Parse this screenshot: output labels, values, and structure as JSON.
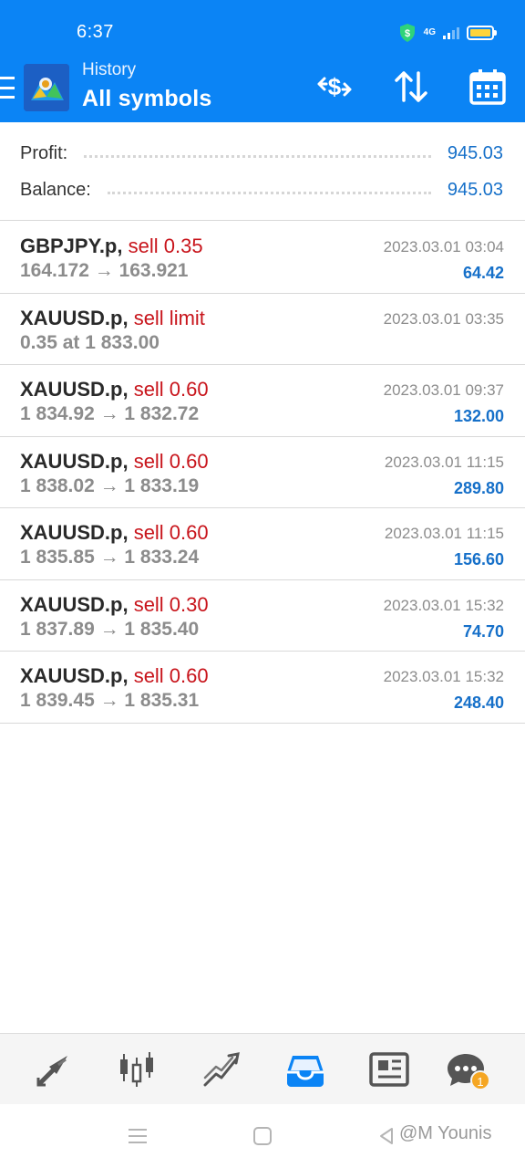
{
  "status_bar": {
    "time": "6:37",
    "network": "4G",
    "battery_color": "#ffd43b"
  },
  "header": {
    "menu_icon": "hamburger-icon",
    "subtitle": "History",
    "title": "All symbols",
    "actions": [
      "deposit-withdraw-icon",
      "sort-icon",
      "calendar-icon"
    ]
  },
  "summary": {
    "profit_label": "Profit:",
    "profit_value": "945.03",
    "balance_label": "Balance:",
    "balance_value": "945.03"
  },
  "trades": [
    {
      "symbol": "GBPJPY.p,",
      "side": "sell 0.35",
      "prices": "164.172 → 163.921",
      "time": "2023.03.01 03:04",
      "profit": "64.42"
    },
    {
      "symbol": "XAUUSD.p,",
      "side": "sell limit",
      "prices": "0.35 at 1 833.00",
      "time": "2023.03.01 03:35",
      "profit": ""
    },
    {
      "symbol": "XAUUSD.p,",
      "side": "sell 0.60",
      "prices": "1 834.92 → 1 832.72",
      "time": "2023.03.01 09:37",
      "profit": "132.00"
    },
    {
      "symbol": "XAUUSD.p,",
      "side": "sell 0.60",
      "prices": "1 838.02 → 1 833.19",
      "time": "2023.03.01 11:15",
      "profit": "289.80"
    },
    {
      "symbol": "XAUUSD.p,",
      "side": "sell 0.60",
      "prices": "1 835.85 → 1 833.24",
      "time": "2023.03.01 11:15",
      "profit": "156.60"
    },
    {
      "symbol": "XAUUSD.p,",
      "side": "sell 0.30",
      "prices": "1 837.89 → 1 835.40",
      "time": "2023.03.01 15:32",
      "profit": "74.70"
    },
    {
      "symbol": "XAUUSD.p,",
      "side": "sell 0.60",
      "prices": "1 839.45 → 1 835.31",
      "time": "2023.03.01 15:32",
      "profit": "248.40"
    }
  ],
  "bottom_nav": {
    "items": [
      "quotes-icon",
      "chart-icon",
      "trade-icon",
      "history-icon",
      "news-icon",
      "chat-icon"
    ],
    "active": "history-icon",
    "chat_badge": "1"
  },
  "watermark": "@M Younis",
  "colors": {
    "header_bg": "#0b84f5",
    "sell": "#c8141b",
    "profit": "#1670c9",
    "active_tab": "#0b84f5",
    "badge": "#f5a623"
  }
}
